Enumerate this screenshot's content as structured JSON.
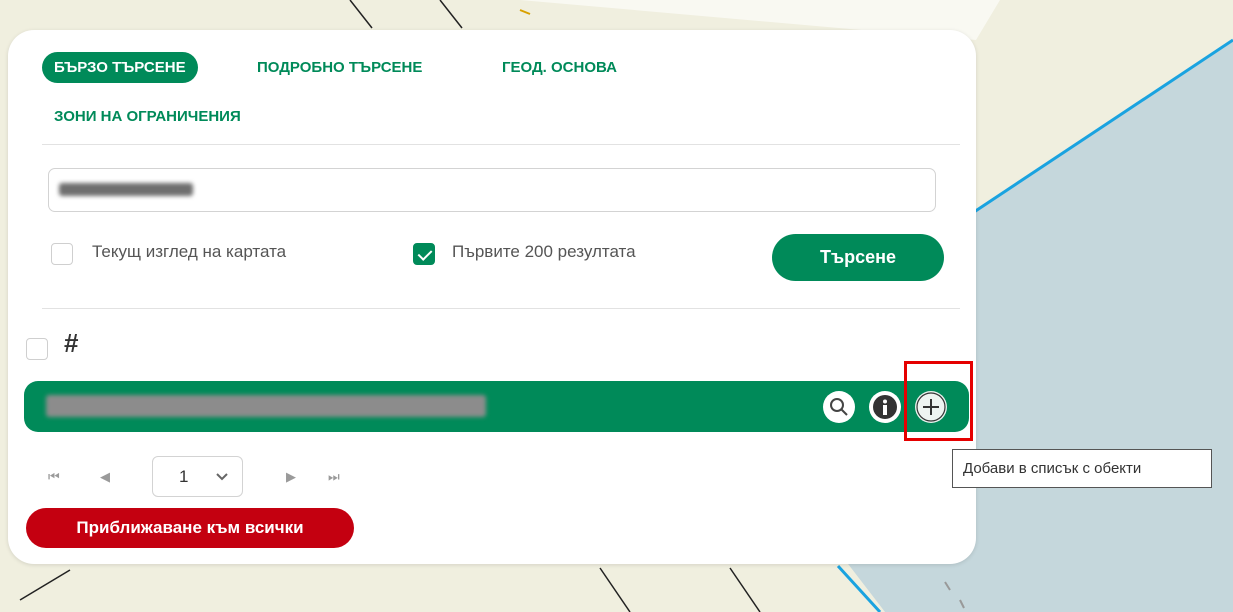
{
  "tabs": [
    {
      "label": "БЪРЗО ТЪРСЕНЕ",
      "active": true
    },
    {
      "label": "ПОДРОБНО ТЪРСЕНЕ",
      "active": false
    },
    {
      "label": "ГЕОД. ОСНОВА",
      "active": false
    },
    {
      "label": "ЗОНИ НА ОГРАНИЧЕНИЯ",
      "active": false
    }
  ],
  "search": {
    "current_view_label": "Текущ изглед на картата",
    "current_view_checked": false,
    "first200_label": "Първите 200 резултата",
    "first200_checked": true,
    "button_label": "Търсене"
  },
  "results": {
    "select_all_checked": false,
    "grid_icon": "grid-icon",
    "row_icons": [
      "search-icon",
      "info-icon",
      "plus-icon"
    ]
  },
  "pager": {
    "first": "⏮",
    "prev": "◀",
    "current_page": "1",
    "next": "▶",
    "last": "⏭"
  },
  "zoom_all_label": "Приближаване към всички",
  "tooltip": "Добави в списък с обекти",
  "colors": {
    "accent": "#008a59",
    "danger": "#c40010",
    "highlight": "#e50000",
    "map_land": "#f0efdf",
    "map_water": "#c5d7dc",
    "map_line": "#1aa3e0"
  }
}
